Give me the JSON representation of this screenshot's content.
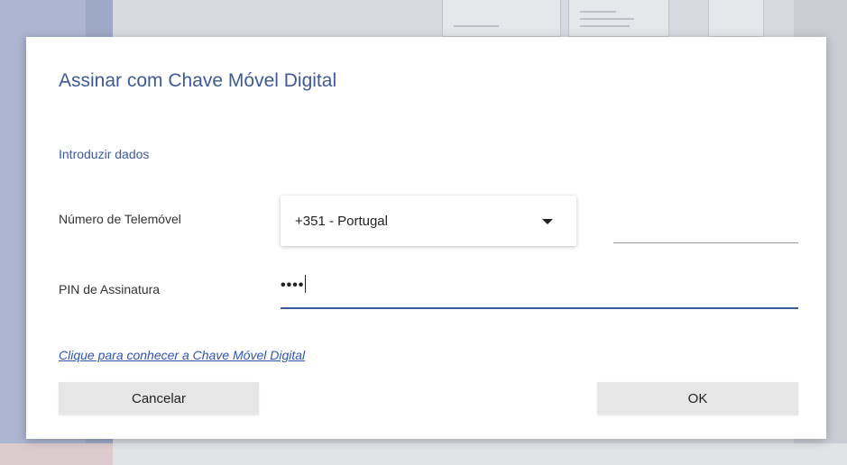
{
  "dialog": {
    "title": "Assinar com Chave Móvel Digital",
    "section_title": "Introduzir dados",
    "phone": {
      "label": "Número de Telemóvel",
      "country_selected": "+351 - Portugal",
      "number_value": ""
    },
    "pin": {
      "label": "PIN de Assinatura",
      "masked_value": "••••"
    },
    "info_link": "Clique para conhecer a Chave Móvel Digital",
    "buttons": {
      "cancel": "Cancelar",
      "ok": "OK"
    }
  },
  "colors": {
    "accent": "#3d5a99",
    "link": "#2f55b4",
    "button_bg": "#e6e6e6"
  },
  "icons": {
    "dropdown": "chevron-down-icon"
  }
}
